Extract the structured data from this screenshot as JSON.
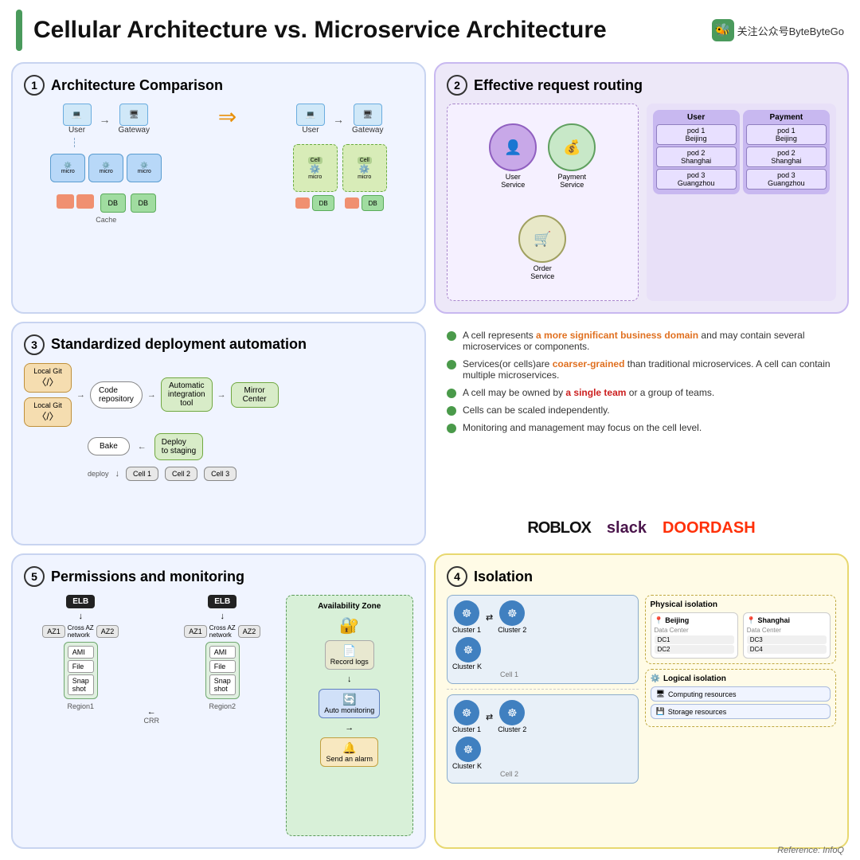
{
  "header": {
    "title": "Cellular Architecture vs. Microservice Architecture",
    "logo_text": "关注公众号ByteByteGo"
  },
  "panel1": {
    "number": "1",
    "title": "Architecture Comparison",
    "left": {
      "user_label": "User",
      "gateway_label": "Gateway",
      "ms_labels": [
        "microservice",
        "microservice",
        "microservice"
      ],
      "cache_label": "Cache",
      "db_labels": [
        "DB",
        "DB"
      ]
    },
    "right": {
      "user_label": "User",
      "gateway_label": "Gateway",
      "cell_labels": [
        "Cell",
        "Cell"
      ],
      "ms_labels": [
        "microservice",
        "microservice"
      ],
      "db_labels": [
        "DB",
        "DB"
      ]
    }
  },
  "panel2": {
    "number": "2",
    "title": "Effective request routing",
    "services": [
      "User Service",
      "Payment Service",
      "Order Service"
    ],
    "columns": [
      "User",
      "Payment"
    ],
    "pods": {
      "user": [
        "pod 1\nBeijing",
        "pod 2\nShanghai",
        "pod 3\nGuangzhou"
      ],
      "payment": [
        "pod 1\nBeijing",
        "pod 2\nShanghai",
        "pod 3\nGuangzhou"
      ]
    }
  },
  "panel3": {
    "number": "3",
    "title": "Standardized deployment automation",
    "nodes": {
      "local_git1": "Local Git",
      "local_git2": "Local Git",
      "code_repo": "Code repository",
      "auto_integration": "Automatic integration tool",
      "mirror_center": "Mirror Center",
      "bake": "Bake",
      "deploy_staging": "Deploy to staging",
      "cell1": "Cell 1",
      "cell2": "Cell 2",
      "cell3": "Cell 3",
      "deploy_label": "deploy"
    }
  },
  "panel_info": {
    "points": [
      {
        "text_before": "A cell represents ",
        "highlight": "a more significant business domain",
        "highlight_color": "orange",
        "text_after": " and may contain several microservices or components."
      },
      {
        "text_before": "Services(or cells)are ",
        "highlight": "coarser-grained",
        "highlight_color": "orange",
        "text_after": " than traditional microservices. A cell can contain multiple microservices."
      },
      {
        "text_before": "A cell may be owned by ",
        "highlight": "a single team",
        "highlight_color": "red",
        "text_after": " or a group of teams."
      },
      {
        "text_before": "Cells can be scaled independently.",
        "highlight": "",
        "highlight_color": "",
        "text_after": ""
      },
      {
        "text_before": "Monitoring and management may focus on the cell level.",
        "highlight": "",
        "highlight_color": "",
        "text_after": ""
      }
    ],
    "logos": [
      "ROBLOX",
      "slack",
      "DOORDASH"
    ]
  },
  "panel5": {
    "number": "5",
    "title": "Permissions and monitoring",
    "region1": "Region1",
    "region2": "Region2",
    "avail_zone": "Availability Zone",
    "record_logs": "Record logs",
    "auto_monitoring": "Auto monitoring",
    "send_alarm": "Send an alarm",
    "crr_label": "CRR"
  },
  "panel4": {
    "number": "4",
    "title": "Isolation",
    "clusters": [
      "Cluster 1",
      "Cluster 2",
      "Cluster K"
    ],
    "cell_labels": [
      "Cell 1",
      "Cell 2"
    ],
    "physical_title": "Physical isolation",
    "cities": {
      "beijing": {
        "name": "Beijing",
        "dcs": [
          "DC1",
          "DC2"
        ]
      },
      "shanghai": {
        "name": "Shanghai",
        "dcs": [
          "DC3",
          "DC4"
        ]
      }
    },
    "logical_title": "Logical isolation",
    "resources": [
      "Computing resources",
      "Storage resources"
    ],
    "data_center_label": "Data Center"
  },
  "reference": "Reference: InfoQ"
}
